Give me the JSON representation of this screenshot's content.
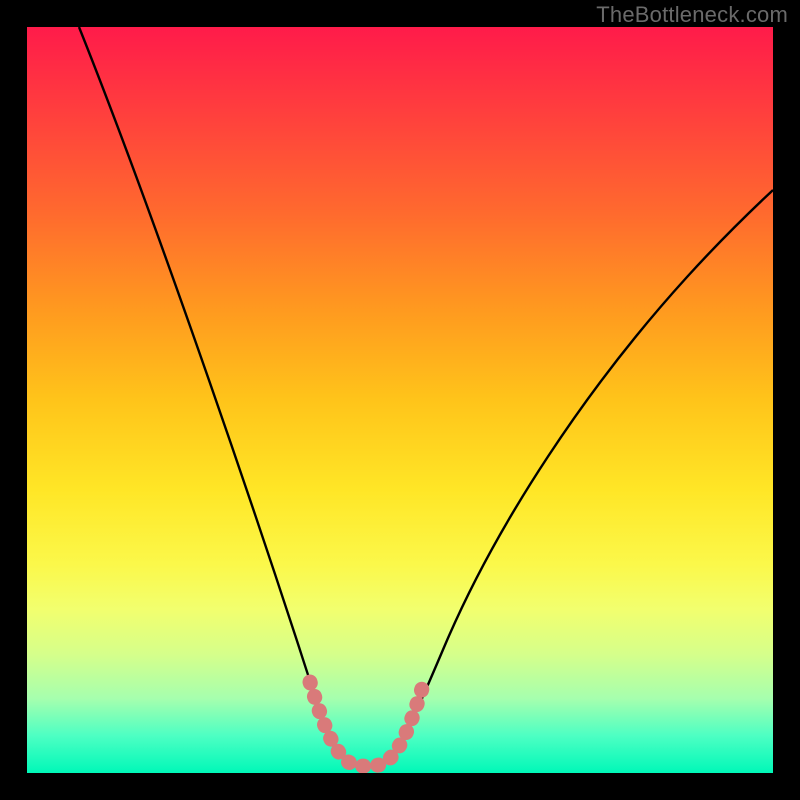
{
  "watermark": "TheBottleneck.com",
  "chart_data": {
    "type": "line",
    "title": "",
    "xlabel": "",
    "ylabel": "",
    "xlim": [
      0,
      100
    ],
    "ylim": [
      0,
      100
    ],
    "series": [
      {
        "name": "bottleneck-curve",
        "x": [
          7,
          10,
          15,
          20,
          25,
          30,
          34,
          37,
          39,
          41,
          43,
          45,
          47,
          49,
          52,
          56,
          61,
          67,
          74,
          82,
          90,
          100
        ],
        "y": [
          100,
          90,
          75,
          60,
          46,
          33,
          22,
          13,
          7,
          3,
          1,
          1,
          1,
          3,
          7,
          14,
          23,
          34,
          46,
          58,
          68,
          79
        ]
      }
    ],
    "highlight": {
      "name": "v-floor",
      "x": [
        39,
        41,
        43,
        45,
        47,
        49,
        51
      ],
      "y": [
        7,
        3,
        1,
        1,
        1,
        3,
        7
      ]
    },
    "gradient_stops": [
      {
        "pct": 0,
        "color": "#ff1b4a"
      },
      {
        "pct": 10,
        "color": "#ff3a3f"
      },
      {
        "pct": 25,
        "color": "#ff6a2e"
      },
      {
        "pct": 38,
        "color": "#ff9a1f"
      },
      {
        "pct": 50,
        "color": "#ffc41a"
      },
      {
        "pct": 62,
        "color": "#ffe626"
      },
      {
        "pct": 72,
        "color": "#fbf84a"
      },
      {
        "pct": 78,
        "color": "#f2ff6e"
      },
      {
        "pct": 84,
        "color": "#d6ff8a"
      },
      {
        "pct": 90,
        "color": "#a6ffae"
      },
      {
        "pct": 95,
        "color": "#4dffc3"
      },
      {
        "pct": 100,
        "color": "#00f8b8"
      }
    ],
    "colors": {
      "curve": "#000000",
      "highlight": "#d97a7a",
      "frame": "#000000",
      "watermark": "#6a6a6a"
    }
  }
}
